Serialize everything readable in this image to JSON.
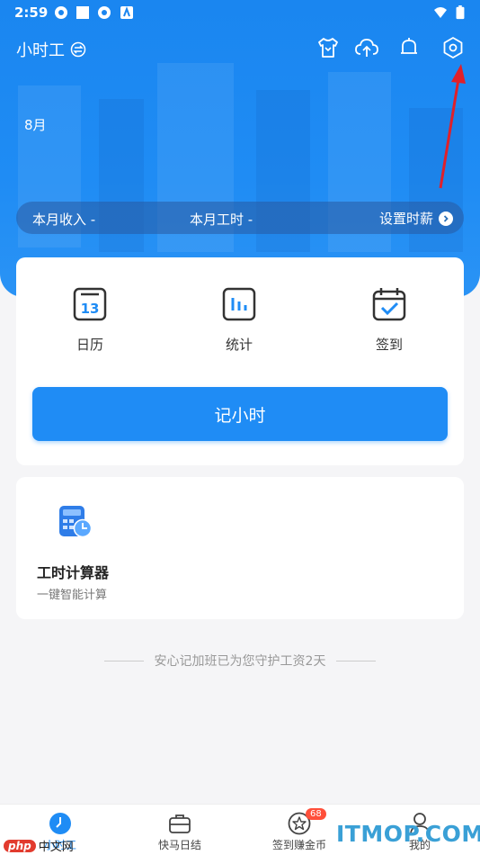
{
  "status_bar": {
    "time": "2:59"
  },
  "header": {
    "title": "小时工",
    "month": "8月"
  },
  "stats": {
    "income_label": "本月收入 -",
    "hours_label": "本月工时 -",
    "set_wage_label": "设置时薪"
  },
  "tools": [
    {
      "label": "日历",
      "date_number": "13"
    },
    {
      "label": "统计"
    },
    {
      "label": "签到"
    }
  ],
  "cta_label": "记小时",
  "calculator": {
    "title": "工时计算器",
    "subtitle": "一键智能计算"
  },
  "footer_note": "安心记加班已为您守护工资2天",
  "tabbar": {
    "items": [
      {
        "label": "小时工"
      },
      {
        "label": "快马日结"
      },
      {
        "label": "签到赚金币",
        "badge": "68"
      },
      {
        "label": "我的"
      }
    ]
  },
  "watermarks": {
    "left_php": "php",
    "left_text": "中文网",
    "right": "ITMOP.COM"
  },
  "colors": {
    "brand_blue": "#1f8cf5",
    "badge_red": "#ff4f3a",
    "arrow_red": "#e0202a"
  }
}
